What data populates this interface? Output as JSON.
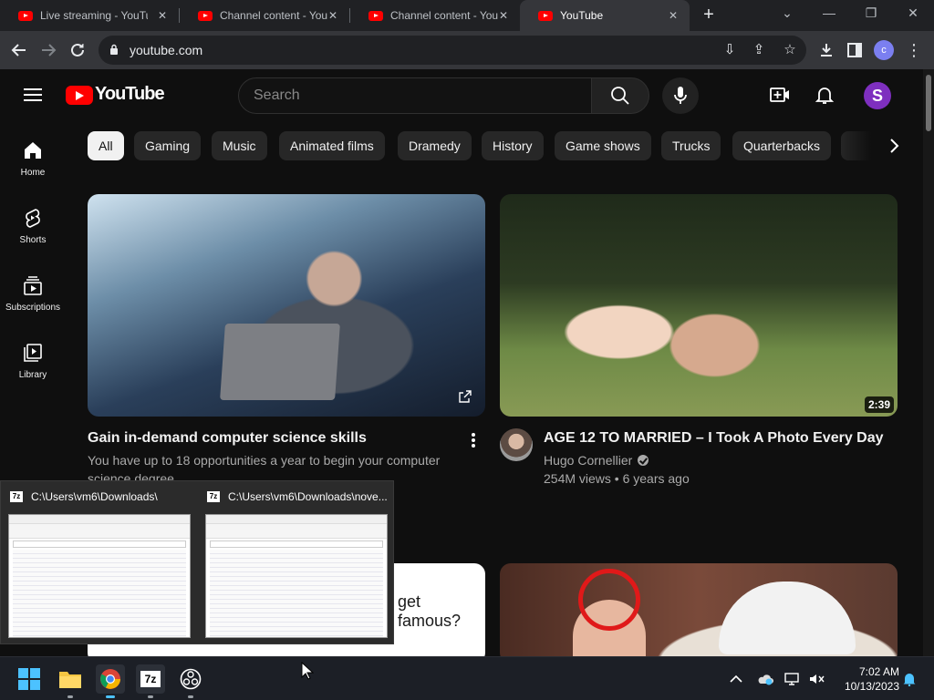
{
  "browser": {
    "tabs": [
      {
        "title": "Live streaming - YouTube",
        "active": false
      },
      {
        "title": "Channel content - YouTube",
        "active": false
      },
      {
        "title": "Channel content - YouTube",
        "active": false
      },
      {
        "title": "YouTube",
        "active": true
      }
    ],
    "url": "youtube.com",
    "profile_initial": "c"
  },
  "youtube": {
    "wordmark": "YouTube",
    "search_placeholder": "Search",
    "avatar_initial": "S",
    "guide": [
      {
        "label": "Home",
        "icon": "home-icon"
      },
      {
        "label": "Shorts",
        "icon": "shorts-icon"
      },
      {
        "label": "Subscriptions",
        "icon": "subscriptions-icon"
      },
      {
        "label": "Library",
        "icon": "library-icon"
      }
    ],
    "chips": [
      "All",
      "Gaming",
      "Music",
      "Animated films",
      "Dramedy",
      "History",
      "Game shows",
      "Trucks",
      "Quarterbacks"
    ],
    "videos": [
      {
        "title": "Gain in-demand computer science skills",
        "description": "You have up to 18 opportunities a year to begin your computer science degree."
      },
      {
        "title": "AGE 12 TO MARRIED – I Took A Photo Every Day",
        "channel": "Hugo Cornellier",
        "meta": "254M views • 6 years ago",
        "duration": "2:39"
      },
      {
        "thumb_text": "get famous?"
      }
    ]
  },
  "preview": {
    "windows": [
      {
        "title": "C:\\Users\\vm6\\Downloads\\"
      },
      {
        "title": "C:\\Users\\vm6\\Downloads\\nove..."
      }
    ]
  },
  "taskbar": {
    "time": "7:02 AM",
    "date": "10/13/2023",
    "app_7z_label": "7z"
  },
  "colors": {
    "accent_red": "#ff0000",
    "bg": "#0f0f0f",
    "chip": "#272727"
  }
}
